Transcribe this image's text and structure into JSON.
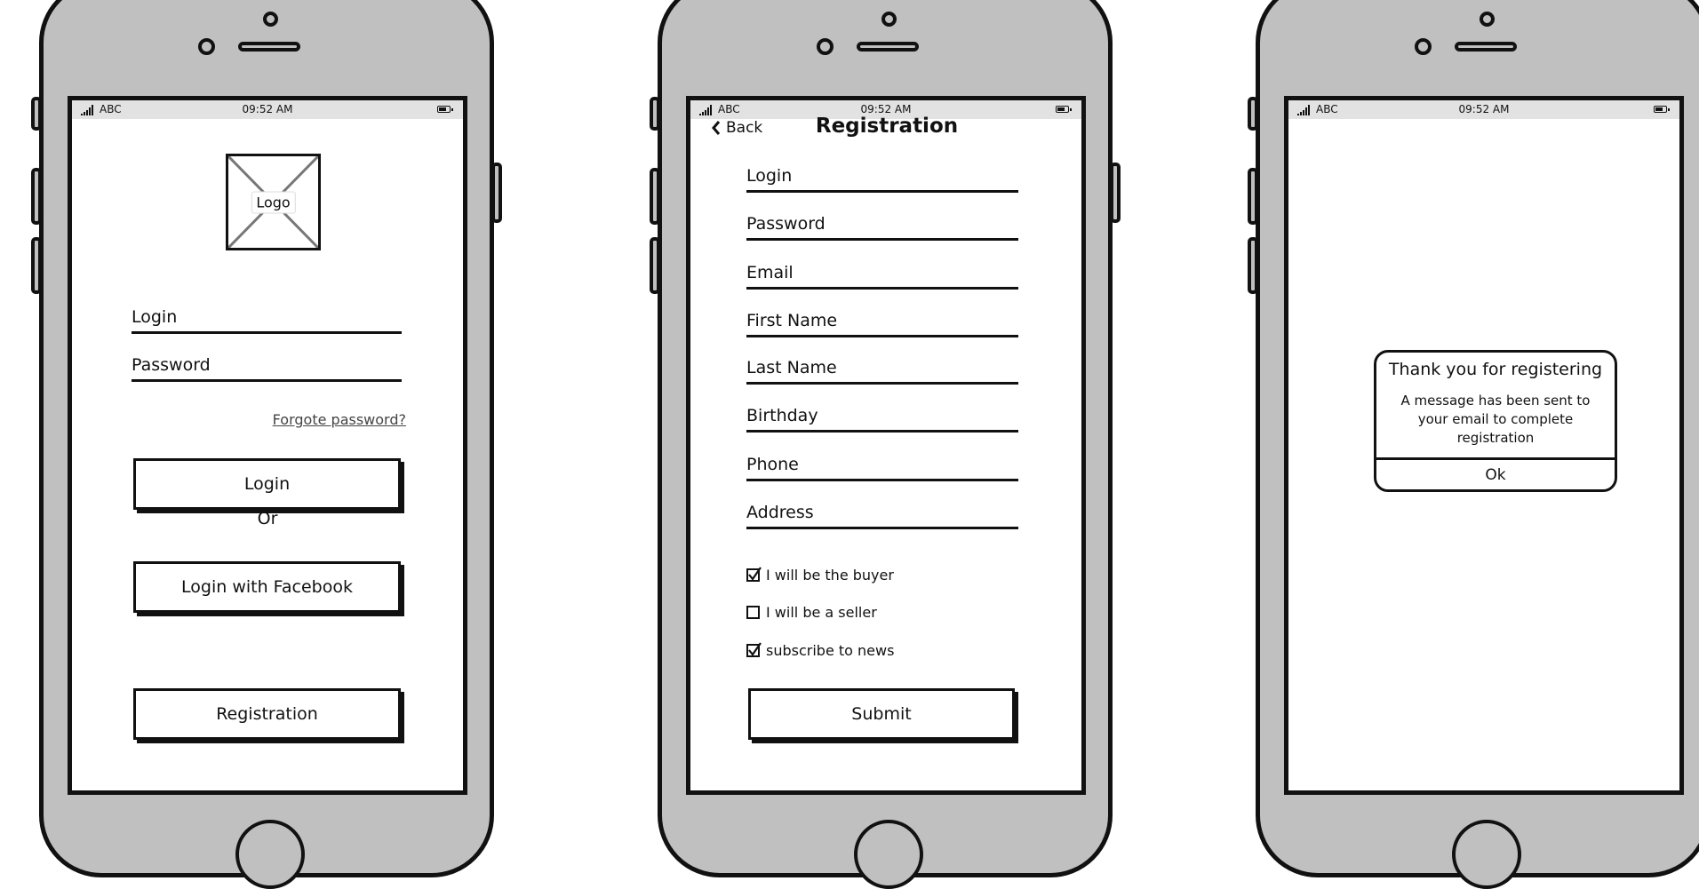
{
  "status_bar": {
    "carrier": "ABC",
    "time": "09:52 AM"
  },
  "login_screen": {
    "logo_label": "Logo",
    "login_field": "Login",
    "password_field": "Password",
    "forgot_link": "Forgote password?",
    "login_button": "Login",
    "or_text": "Or",
    "facebook_button": "Login with Facebook",
    "registration_button": "Registration"
  },
  "registration_screen": {
    "back_label": "Back",
    "title": "Registration",
    "fields": [
      "Login",
      "Password",
      "Email",
      "First Name",
      "Last Name",
      "Birthday",
      "Phone",
      "Address"
    ],
    "checkboxes": [
      {
        "label": "I will be the buyer",
        "checked": true
      },
      {
        "label": "I will be a seller",
        "checked": false
      },
      {
        "label": "subscribe to news",
        "checked": true
      }
    ],
    "submit_button": "Submit"
  },
  "confirmation_screen": {
    "dialog_title": "Thank you for registering",
    "dialog_message": "A message has been sent to your email to complete registration",
    "ok_button": "Ok"
  }
}
